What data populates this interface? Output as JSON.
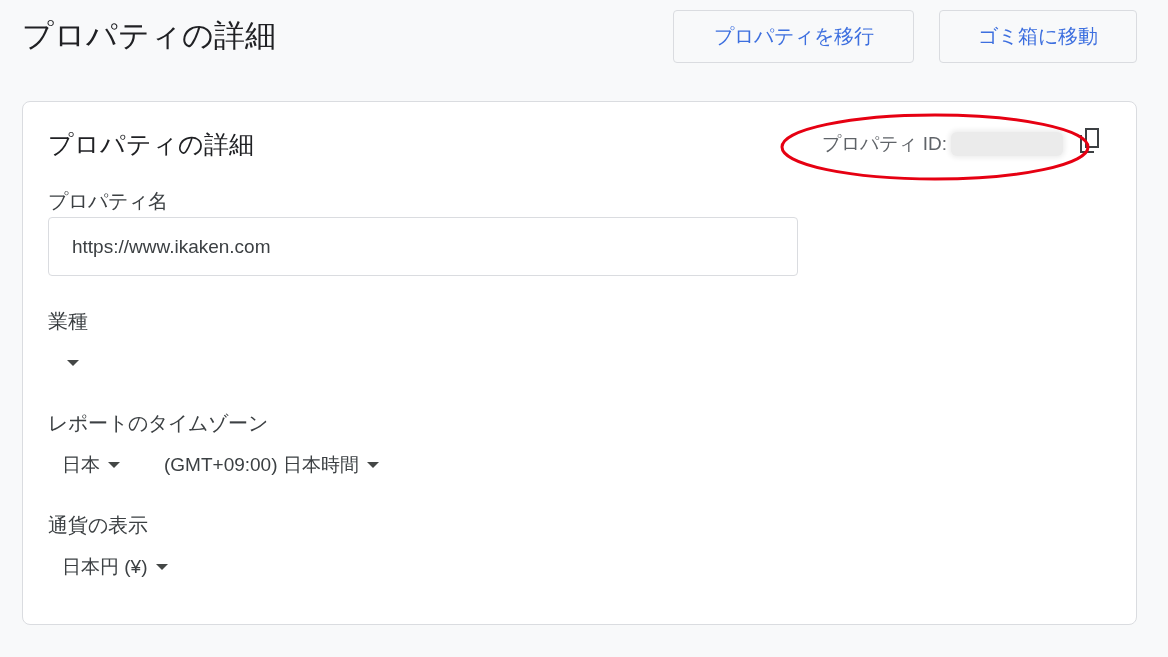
{
  "page": {
    "title": "プロパティの詳細"
  },
  "actions": [
    {
      "label": "プロパティを移行"
    },
    {
      "label": "ゴミ箱に移動"
    }
  ],
  "card": {
    "title": "プロパティの詳細",
    "property_id": {
      "label": "プロパティ ID:"
    },
    "highlight": {
      "kind": "ellipse"
    },
    "fields": [
      {
        "kind": "text",
        "label": "プロパティ名",
        "value": "https://www.ikaken.com"
      },
      {
        "kind": "empty_select",
        "label": "業種"
      },
      {
        "kind": "select",
        "label": "レポートのタイムゾーン",
        "selects": [
          {
            "value": "日本"
          },
          {
            "value": "(GMT+09:00) 日本時間"
          }
        ]
      },
      {
        "kind": "select",
        "label": "通貨の表示",
        "selects": [
          {
            "value": "日本円 (¥)"
          }
        ]
      }
    ]
  }
}
